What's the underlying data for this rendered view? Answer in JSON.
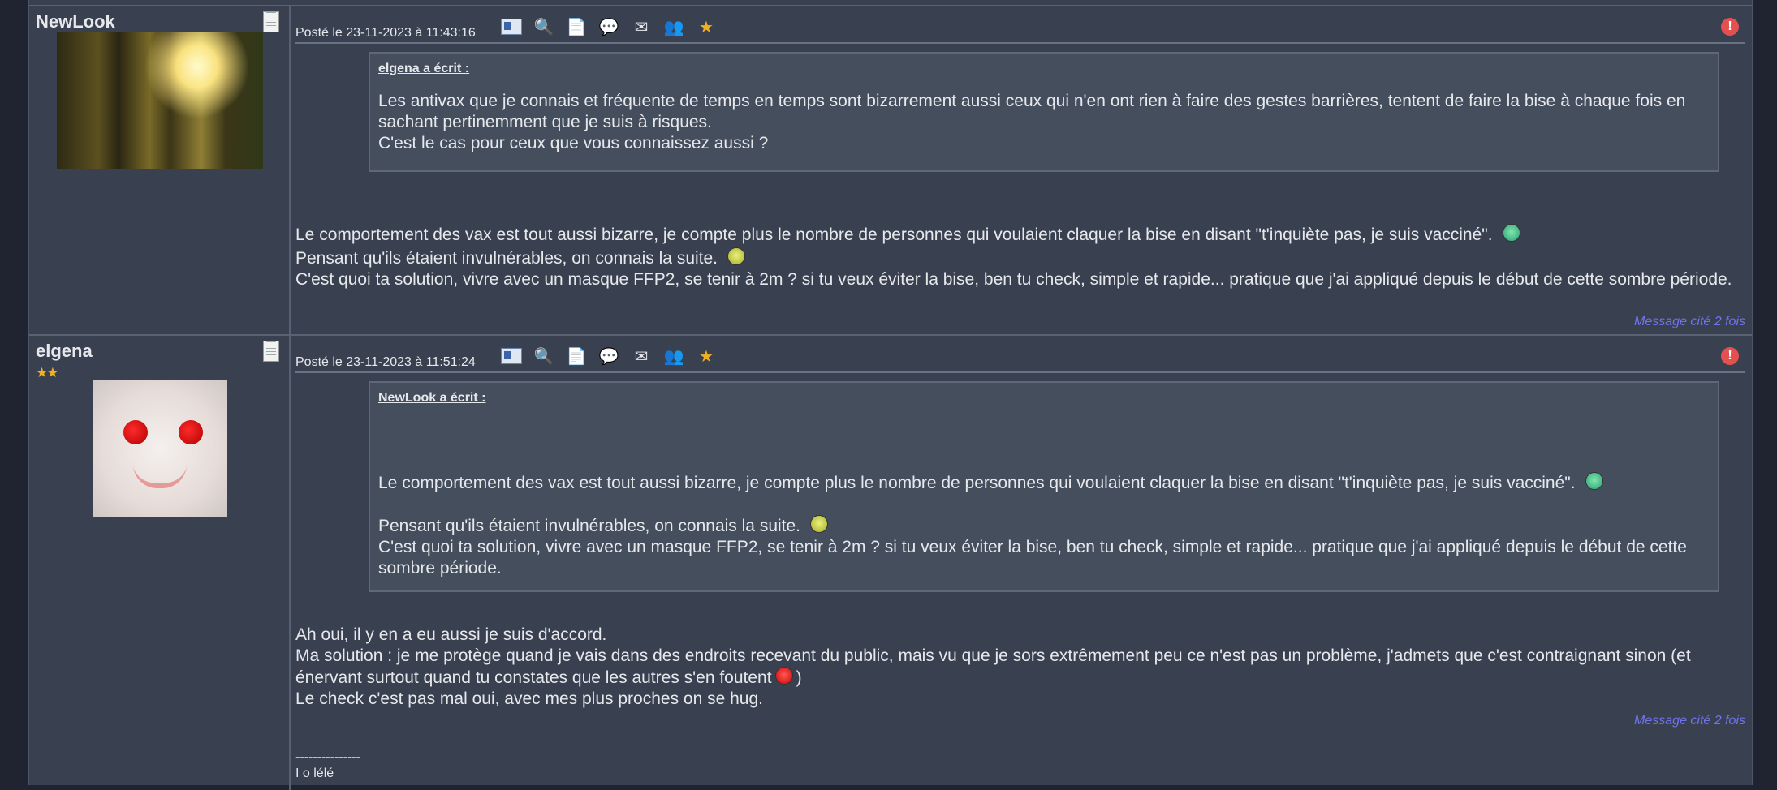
{
  "posts": [
    {
      "author": "NewLook",
      "posted": "Posté le 23-11-2023 à 11:43:16",
      "quote_author": "elgena a écrit :",
      "quote_lines": [
        "Les antivax que je connais et fréquente de temps en temps sont bizarrement aussi ceux qui n'en ont rien à faire des gestes barrières, tentent de faire la bise à chaque fois en sachant pertinemment que je suis à risques.",
        "C'est le cas pour ceux que vous connaissez aussi ?"
      ],
      "body_lines": [
        "Le comportement des vax est tout aussi bizarre, je compte plus le nombre de personnes qui voulaient claquer la bise en disant \"t'inquiète pas, je suis vacciné\".",
        "Pensant qu'ils étaient invulnérables, on connais la suite.",
        "C'est quoi ta solution, vivre avec un masque FFP2, se tenir à 2m ? si tu veux éviter la bise, ben tu check, simple et rapide... pratique que j'ai appliqué depuis le début de cette sombre période."
      ],
      "cited": "Message cité 2 fois"
    },
    {
      "author": "elgena",
      "rank_stars": "★★",
      "posted": "Posté le 23-11-2023 à 11:51:24",
      "quote_author": "NewLook a écrit :",
      "quote_lines": [
        "Le comportement des vax est tout aussi bizarre, je compte plus le nombre de personnes qui voulaient claquer la bise en disant \"t'inquiète pas, je suis vacciné\".",
        "Pensant qu'ils étaient invulnérables, on connais la suite.",
        "C'est quoi ta solution, vivre avec un masque FFP2, se tenir à 2m ? si tu veux éviter la bise, ben tu check, simple et rapide... pratique que j'ai appliqué depuis le début de cette sombre période."
      ],
      "body_lines": [
        "Ah oui, il y en a eu aussi je suis d'accord.",
        "Ma solution : je me protège quand je vais dans des endroits recevant du public, mais vu que je sors extrêmement peu ce n'est pas un problème, j'admets que c'est contraignant sinon (et énervant surtout quand tu constates que les autres s'en foutent",
        ")",
        "Le check c'est pas mal oui, avec mes plus proches on se hug."
      ],
      "cited": "Message cité 2 fois",
      "signature": [
        "---------------",
        "I o lélé"
      ]
    }
  ],
  "icons": [
    "profile-card-icon",
    "view-icon",
    "add-icon",
    "private-message-icon",
    "edit-icon",
    "users-icon",
    "favorite-star-icon",
    "report-icon"
  ]
}
